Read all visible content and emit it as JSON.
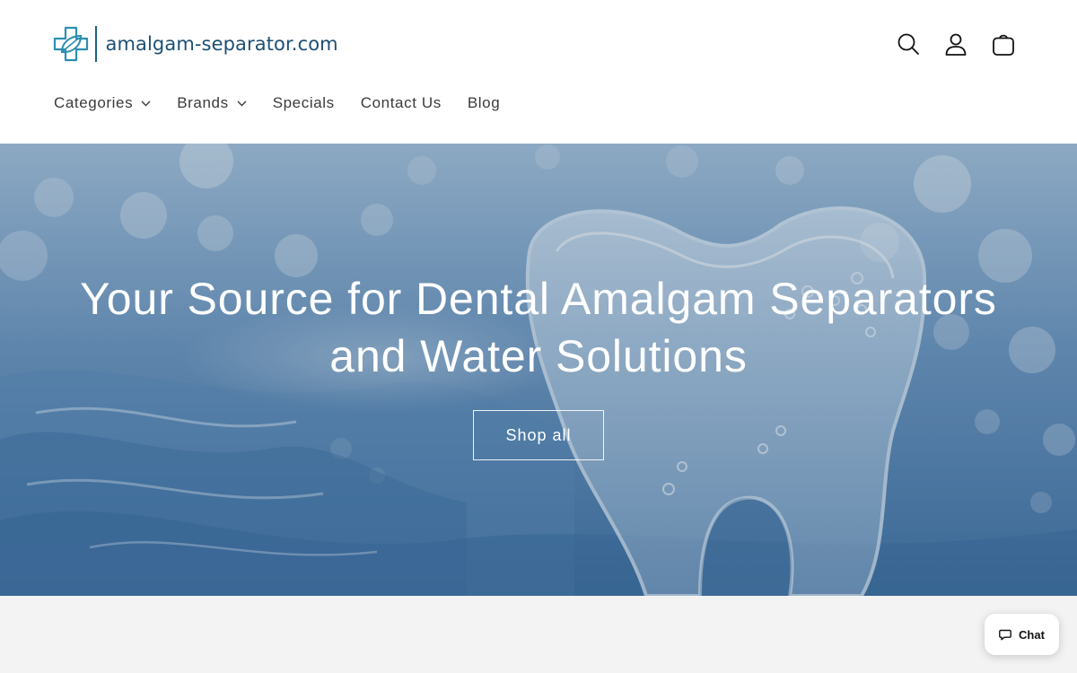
{
  "brand": {
    "logo_text": "amalgam-separator.com",
    "logo_icon": "medical-cross-leaf-icon",
    "color": "#1e4f74",
    "accent": "#2c8fb0"
  },
  "header_icons": [
    {
      "name": "search-icon"
    },
    {
      "name": "account-icon"
    },
    {
      "name": "cart-icon"
    }
  ],
  "nav": {
    "items": [
      {
        "label": "Categories",
        "has_dropdown": true
      },
      {
        "label": "Brands",
        "has_dropdown": true
      },
      {
        "label": "Specials",
        "has_dropdown": false
      },
      {
        "label": "Contact Us",
        "has_dropdown": false
      },
      {
        "label": "Blog",
        "has_dropdown": false
      }
    ]
  },
  "hero": {
    "title": "Your Source for Dental Amalgam Separators and Water Solutions",
    "button_label": "Shop all",
    "background_image": "glass-tooth-in-water-icon",
    "overlay_color": "#5d87ad"
  },
  "chat": {
    "label": "Chat",
    "icon": "chat-bubble-icon"
  }
}
